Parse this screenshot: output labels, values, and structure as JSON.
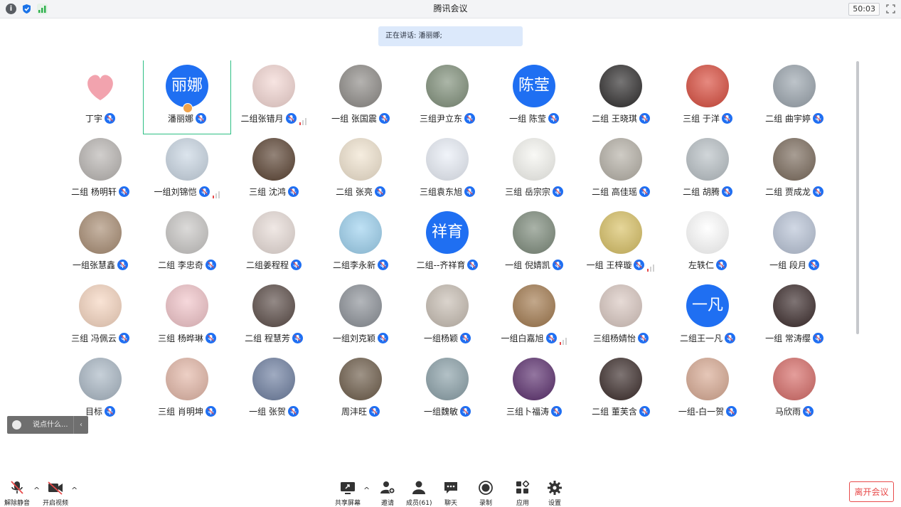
{
  "window": {
    "title": "腾讯会议",
    "timer": "50:03"
  },
  "speaking": "正在讲话: 潘丽娜;",
  "participants": [
    {
      "name": "丁宇",
      "avatar": "heart-icon",
      "bg": "#ffffff"
    },
    {
      "name": "潘丽娜",
      "avatar_text": "丽娜",
      "bg": "#1f6ff2",
      "active": true,
      "host": true
    },
    {
      "name": "二组张错月",
      "avatar": "photo",
      "bg": "#f3d6d2",
      "volume": true
    },
    {
      "name": "一组 张国震",
      "avatar": "photo",
      "bg": "#8d8a86"
    },
    {
      "name": "三组尹立东",
      "avatar": "photo",
      "bg": "#7f8f79"
    },
    {
      "name": "一组 陈莹",
      "avatar_text": "陈莹",
      "bg": "#1f6ff2"
    },
    {
      "name": "二组 王晓琪",
      "avatar": "photo",
      "bg": "#2d2b2b"
    },
    {
      "name": "三组 于洋",
      "avatar": "photo",
      "bg": "#d94a3b"
    },
    {
      "name": "二组 曲宇婷",
      "avatar": "photo",
      "bg": "#9aa4ad"
    },
    {
      "name": "二组 杨明轩",
      "avatar": "photo",
      "bg": "#b9b5b2"
    },
    {
      "name": "一组刘锦恺",
      "avatar": "photo",
      "bg": "#c9d6e3",
      "volume": true
    },
    {
      "name": "三组 沈鸿",
      "avatar": "photo",
      "bg": "#5a4231"
    },
    {
      "name": "二组 张亮",
      "avatar": "photo",
      "bg": "#f1e4cf"
    },
    {
      "name": "三组袁东旭",
      "avatar": "photo",
      "bg": "#e9eef7"
    },
    {
      "name": "三组 岳宗宗",
      "avatar": "photo",
      "bg": "#f6f6f1"
    },
    {
      "name": "二组 高佳瑶",
      "avatar": "photo",
      "bg": "#b5b0a6"
    },
    {
      "name": "二组 胡腾",
      "avatar": "photo",
      "bg": "#b8c0c5"
    },
    {
      "name": "二组 贾成龙",
      "avatar": "photo",
      "bg": "#7a6a5b"
    },
    {
      "name": "一组张慧鑫",
      "avatar": "photo",
      "bg": "#a88c72"
    },
    {
      "name": "二组 李忠奇",
      "avatar": "photo",
      "bg": "#c8c6c4"
    },
    {
      "name": "二组姜程程",
      "avatar": "photo",
      "bg": "#e8dcd7"
    },
    {
      "name": "二组李永新",
      "avatar": "photo",
      "bg": "#9cd1ef"
    },
    {
      "name": "二组--齐祥育",
      "avatar_text": "祥育",
      "bg": "#1f6ff2"
    },
    {
      "name": "一组 倪婧凯",
      "avatar": "photo",
      "bg": "#7c8a7a"
    },
    {
      "name": "一组 王梓璇",
      "avatar": "photo",
      "bg": "#d8c063",
      "volume": true
    },
    {
      "name": "左轶仁",
      "avatar": "photo",
      "bg": "#ffffff"
    },
    {
      "name": "一组 段月",
      "avatar": "photo",
      "bg": "#b8c3d6"
    },
    {
      "name": "三组 冯佩云",
      "avatar": "photo",
      "bg": "#f6d5bf"
    },
    {
      "name": "三组 杨晔琳",
      "avatar": "photo",
      "bg": "#f1c3c8"
    },
    {
      "name": "二组  程慧芳",
      "avatar": "photo",
      "bg": "#5a4b46"
    },
    {
      "name": "一组刘克颖",
      "avatar": "photo",
      "bg": "#8b9097"
    },
    {
      "name": "一组杨颖",
      "avatar": "photo",
      "bg": "#c7bdb2"
    },
    {
      "name": "一组白嘉旭",
      "avatar": "photo",
      "bg": "#a2794d",
      "volume": true
    },
    {
      "name": "三组杨婧怡",
      "avatar": "photo",
      "bg": "#d9c7c0"
    },
    {
      "name": "二组王一凡",
      "avatar_text": "一凡",
      "bg": "#1f6ff2"
    },
    {
      "name": "一组 常涛缨",
      "avatar": "photo",
      "bg": "#3a2a2a"
    },
    {
      "name": "目标",
      "avatar": "photo",
      "bg": "#a9b7c4"
    },
    {
      "name": "三组 肖明坤",
      "avatar": "photo",
      "bg": "#e3b6a6"
    },
    {
      "name": "一组 张贺",
      "avatar": "photo",
      "bg": "#6d7ea0"
    },
    {
      "name": "周沣旺",
      "avatar": "photo",
      "bg": "#6c5b48"
    },
    {
      "name": "一组魏敏",
      "avatar": "photo",
      "bg": "#8aa0a8"
    },
    {
      "name": "三组卜福涛",
      "avatar": "photo",
      "bg": "#5a2d6d"
    },
    {
      "name": "二组 董芙含",
      "avatar": "photo",
      "bg": "#3a2b29"
    },
    {
      "name": "一组-白一贺",
      "avatar": "photo",
      "bg": "#d8a992"
    },
    {
      "name": "马欣雨",
      "avatar": "photo",
      "bg": "#d66a66"
    }
  ],
  "chat": {
    "placeholder": "说点什么..."
  },
  "toolbar": {
    "unmute": "解除静音",
    "video": "开启视频",
    "share": "共享屏幕",
    "invite": "邀请",
    "members": "成员(61)",
    "chat": "聊天",
    "record": "录制",
    "apps": "应用",
    "settings": "设置",
    "leave": "离开会议"
  },
  "colors": {
    "accent": "#1f6ff2",
    "active_border": "#2dbf84",
    "leave": "#e84b4b"
  }
}
